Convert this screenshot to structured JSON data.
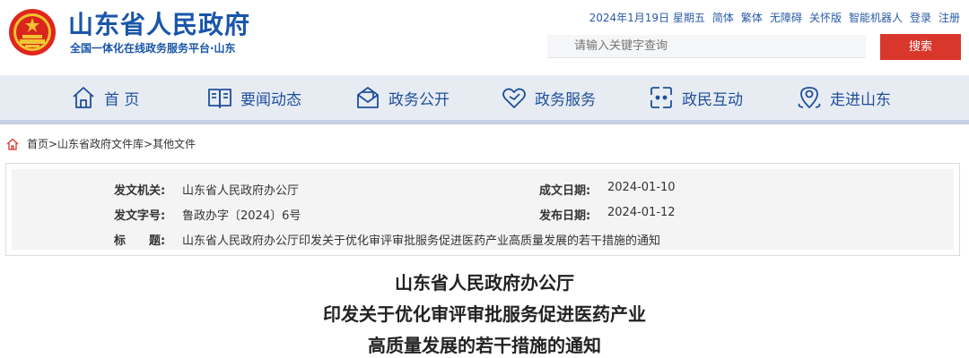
{
  "header": {
    "site_title": "山东省人民政府",
    "site_subtitle": "全国一体化在线政务服务平台·山东",
    "top_links": {
      "date": "2024年1月19日 星期五",
      "simplified": "简体",
      "traditional": "繁体",
      "accessibility": "无障碍",
      "elderly": "关怀版",
      "robot": "智能机器人",
      "login": "登录",
      "register": "注册"
    },
    "search": {
      "placeholder": "请输入关键字查询",
      "button_label": "搜索"
    }
  },
  "nav": {
    "items": [
      {
        "label": "首 页",
        "icon": "home-icon"
      },
      {
        "label": "要闻动态",
        "icon": "news-book-icon"
      },
      {
        "label": "政务公开",
        "icon": "envelope-icon"
      },
      {
        "label": "政务服务",
        "icon": "heart-icon"
      },
      {
        "label": "政民互动",
        "icon": "interaction-icon"
      },
      {
        "label": "走进山东",
        "icon": "location-pin-icon"
      }
    ]
  },
  "breadcrumb": {
    "text": "首页>山东省政府文件库>其他文件"
  },
  "meta": {
    "issuer_label": "发文机关:",
    "issuer_value": "山东省人民政府办公厅",
    "doc_number_label": "发文字号:",
    "doc_number_value": "鲁政办字〔2024〕6号",
    "title_label": "标　　题:",
    "title_value": "山东省人民政府办公厅印发关于优化审评审批服务促进医药产业高质量发展的若干措施的通知",
    "created_label": "成文日期:",
    "created_value": "2024-01-10",
    "published_label": "发布日期:",
    "published_value": "2024-01-12"
  },
  "document": {
    "title_line1": "山东省人民政府办公厅",
    "title_line2": "印发关于优化审评审批服务促进医药产业",
    "title_line3": "高质量发展的若干措施的通知"
  },
  "colors": {
    "brand_blue": "#1a56a8",
    "nav_bg": "#e7ecf3",
    "search_red": "#d9372b"
  }
}
